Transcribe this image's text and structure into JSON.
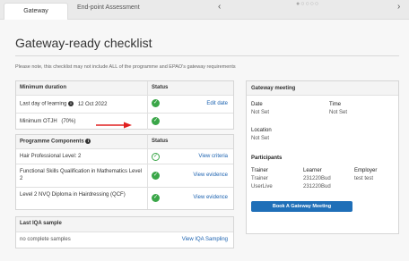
{
  "tabs": {
    "active": "Gateway",
    "inactive": "End-point Assessment"
  },
  "nav": {
    "prev_icon": "‹",
    "next_icon": "›",
    "pager_dots": "●○○○○"
  },
  "page": {
    "title": "Gateway-ready checklist",
    "note": "Please note, this checklist may not include ALL of the programme and EPAO's gateway requirements"
  },
  "minimum_duration": {
    "header": "Minimum duration",
    "status_header": "Status",
    "rows": [
      {
        "label": "Last day of learning",
        "info": "i",
        "value": "12 Oct 2022",
        "status": "✓",
        "link": "Edit date"
      },
      {
        "label": "Minimum OTJH",
        "value": "(70%)",
        "status": "✓"
      }
    ]
  },
  "programme_components": {
    "header": "Programme Components",
    "info": "i",
    "status_header": "Status",
    "rows": [
      {
        "label": "Hair Professional Level: 2",
        "status": "✓",
        "link": "View criteria"
      },
      {
        "label": "Functional Skills Qualification in Mathematics Level 2",
        "status": "✓",
        "link": "View evidence"
      },
      {
        "label": "Level 2 NVQ Diploma in Hairdressing (QCF)",
        "status": "✓",
        "link": "View evidence"
      }
    ]
  },
  "iqa": {
    "header": "Last IQA sample",
    "row_label": "no complete samples",
    "link": "View IQA Sampling"
  },
  "gateway_meeting": {
    "header": "Gateway meeting",
    "date_label": "Date",
    "date_value": "Not Set",
    "time_label": "Time",
    "time_value": "Not Set",
    "location_label": "Location",
    "location_value": "Not Set",
    "participants_label": "Participants",
    "trainer_label": "Trainer",
    "learner_label": "Learner",
    "employer_label": "Employer",
    "trainer_values": [
      "Trainer",
      "UserLive"
    ],
    "learner_values": [
      "231220Bud",
      "231220Bud"
    ],
    "employer_value": "test test",
    "book_button": "Book A Gateway Meeting"
  },
  "colors": {
    "accent": "#1f6fb8",
    "success": "#3aa648",
    "annotation_arrow": "#e02020"
  }
}
